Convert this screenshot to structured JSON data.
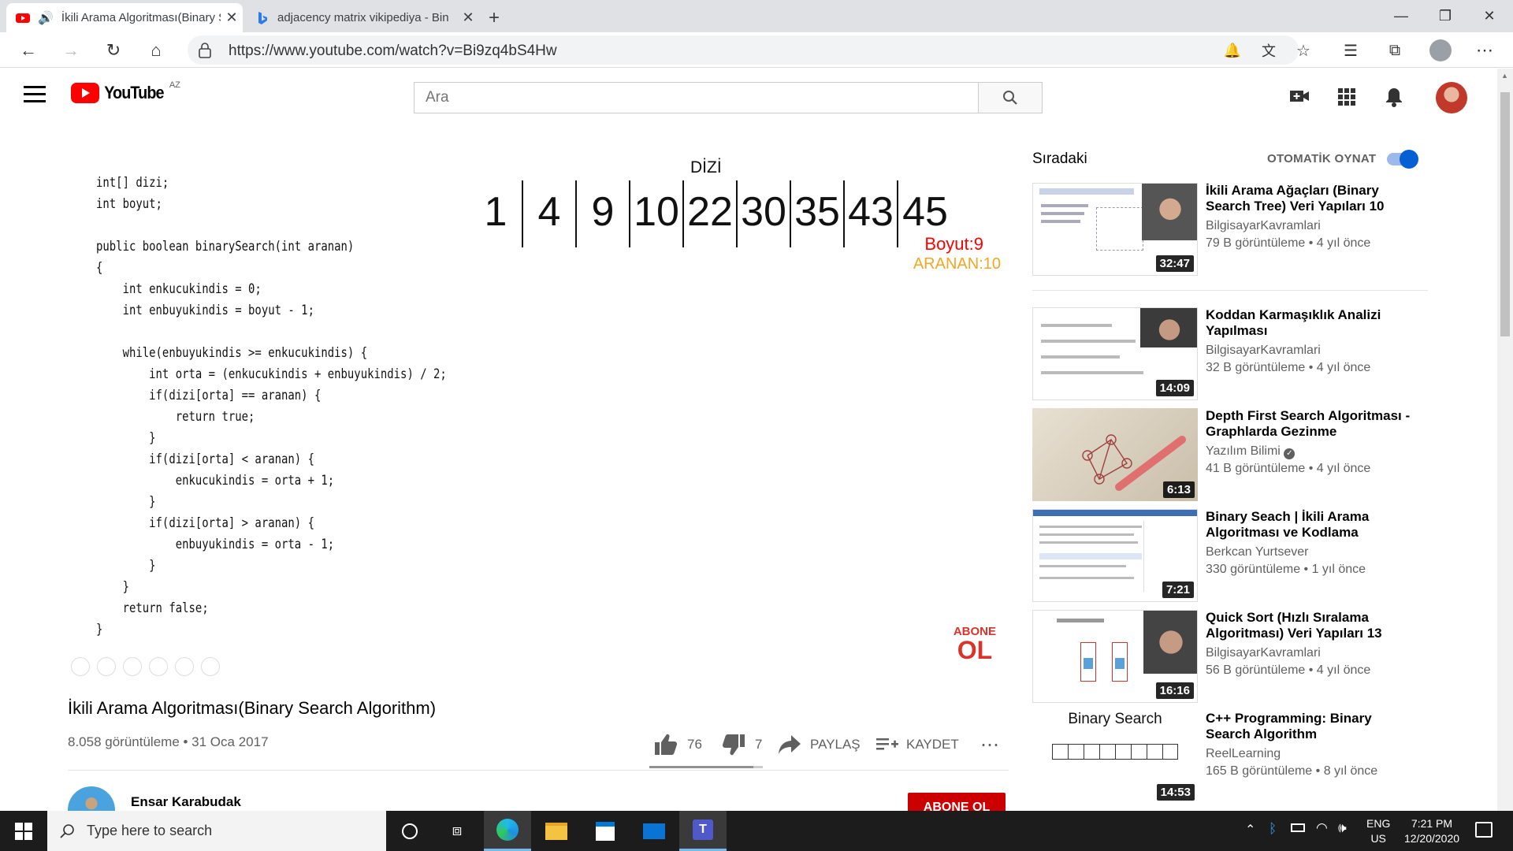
{
  "browser": {
    "tabs": [
      {
        "title": "İkili Arama Algoritması(Binary S",
        "active": true
      },
      {
        "title": "adjacency matrix vikipediya - Bin",
        "active": false
      }
    ],
    "url": "https://www.youtube.com/watch?v=Bi9zq4bS4Hw"
  },
  "youtube": {
    "logo_text": "YouTube",
    "region": "AZ",
    "search_placeholder": "Ara"
  },
  "video": {
    "code_lines": [
      "int[] dizi;",
      "int boyut;",
      "",
      "public boolean binarySearch(int aranan)",
      "{",
      "    int enkucukindis = 0;",
      "    int enbuyukindis = boyut - 1;",
      "",
      "    while(enbuyukindis >= enkucukindis) {",
      "        int orta = (enkucukindis + enbuyukindis) / 2;",
      "        if(dizi[orta] == aranan) {",
      "            return true;",
      "        }",
      "        if(dizi[orta] < aranan) {",
      "            enkucukindis = orta + 1;",
      "        }",
      "        if(dizi[orta] > aranan) {",
      "            enbuyukindis = orta - 1;",
      "        }",
      "    }",
      "    return false;",
      "}"
    ],
    "array_label": "DİZİ",
    "array_values": [
      "1",
      "4",
      "9",
      "10",
      "22",
      "30",
      "35",
      "43",
      "45"
    ],
    "size_label": "Boyut:9",
    "search_label": "ARANAN:10",
    "watermark_line1": "ABONE",
    "watermark_line2": "OL",
    "title": "İkili Arama Algoritması(Binary Search Algorithm)",
    "views_date": "8.058 görüntüleme • 31 Oca 2017",
    "likes": "76",
    "dislikes": "7",
    "like_fraction": 0.916,
    "share_label": "PAYLAŞ",
    "save_label": "KAYDET",
    "channel": "Ensar Karabudak",
    "subscribe_label": "ABONE OL"
  },
  "sidebar": {
    "heading": "Sıradaki",
    "autoplay_label": "OTOMATİK OYNAT",
    "autoplay_on": true,
    "items": [
      {
        "title": "İkili Arama Ağaçları (Binary Search Tree) Veri Yapıları 10",
        "channel": "BilgisayarKavramlari",
        "verified": false,
        "meta": "79 B görüntüleme • 4 yıl önce",
        "duration": "32:47"
      },
      {
        "title": "Koddan Karmaşıklık Analizi Yapılması",
        "channel": "BilgisayarKavramlari",
        "verified": false,
        "meta": "32 B görüntüleme • 4 yıl önce",
        "duration": "14:09"
      },
      {
        "title": "Depth First Search Algoritması - Graphlarda Gezinme",
        "channel": "Yazılım Bilimi",
        "verified": true,
        "meta": "41 B görüntüleme • 4 yıl önce",
        "duration": "6:13"
      },
      {
        "title": "Binary Seach | İkili Arama Algoritması ve Kodlama",
        "channel": "Berkcan Yurtsever",
        "verified": false,
        "meta": "330 görüntüleme • 1 yıl önce",
        "duration": "7:21"
      },
      {
        "title": "Quick Sort (Hızlı Sıralama Algoritması) Veri Yapıları 13",
        "channel": "BilgisayarKavramlari",
        "verified": false,
        "meta": "56 B görüntüleme • 4 yıl önce",
        "duration": "16:16"
      },
      {
        "title": "C++ Programming: Binary Search Algorithm",
        "channel": "ReelLearning",
        "verified": false,
        "meta": "165 B görüntüleme • 8 yıl önce",
        "duration": "14:53",
        "thumb_text": "Binary Search"
      }
    ]
  },
  "taskbar": {
    "search_placeholder": "Type here to search",
    "lang_line1": "ENG",
    "lang_line2": "US",
    "time": "7:21 PM",
    "date": "12/20/2020"
  },
  "colors": {
    "youtube_red": "#ff0000",
    "size_label": "#ff0000",
    "search_label": "#f5a623",
    "autoplay_blue": "#065fd4"
  }
}
